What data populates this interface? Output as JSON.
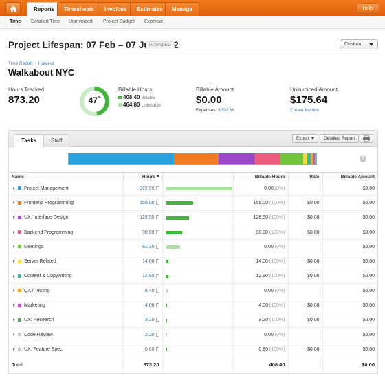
{
  "topnav": {
    "tabs": [
      {
        "label": "Reports",
        "active": true
      },
      {
        "label": "Timesheets",
        "active": false
      },
      {
        "label": "Invoices",
        "active": false
      },
      {
        "label": "Estimates",
        "active": false
      },
      {
        "label": "Manage",
        "active": false
      }
    ],
    "help_label": "Help"
  },
  "subnav": {
    "items": [
      "Time",
      "Detailed Time",
      "Uninvoiced",
      "Project Budget",
      "Expense"
    ]
  },
  "header": {
    "title": "Project Lifespan: 07 Feb – 07 Jun 2012",
    "badge": "ROUNDED",
    "range_select": "Custom"
  },
  "breadcrumb": {
    "items": [
      "Time Report",
      "Harvest"
    ]
  },
  "client_name": "Walkabout NYC",
  "stats": {
    "hours_tracked_label": "Hours Tracked",
    "hours_tracked_value": "873.20",
    "billable_percent": "47",
    "billable_percent_sign": "%",
    "billable_fraction": 0.47,
    "billable_hours_label": "Billable Hours",
    "billable_value": "408.40",
    "billable_sub": "Billable",
    "unbillable_value": "464.80",
    "unbillable_sub": "Unbillable",
    "billable_amount_label": "Billable Amount",
    "billable_amount_value": "$0.00",
    "expenses_label": "Expenses:",
    "expenses_value": "$220.58",
    "uninvoiced_label": "Uninvoiced Amount",
    "uninvoiced_value": "$175.64",
    "create_invoice_label": "Create Invoice"
  },
  "panel": {
    "tabs": [
      "Tasks",
      "Staff"
    ],
    "export_label": "Export",
    "detailed_report_label": "Detailed Report",
    "help_glyph": "?"
  },
  "table": {
    "headers": {
      "name": "Name",
      "hours": "Hours",
      "billable_hours": "Billable Hours",
      "rate": "Rate",
      "billable_amount": "Billable Amount"
    },
    "max_hours": 372.9,
    "rows": [
      {
        "name": "Project Management",
        "color": "#29a3dd",
        "hours": "372.90",
        "hours_num": 372.9,
        "bar_color": "#a8e2a0",
        "billable": "0.00",
        "pct": "(0%)",
        "rate": "",
        "amount": "$0.00"
      },
      {
        "name": "Frontend Programming",
        "color": "#f07b22",
        "hours": "155.00",
        "hours_num": 155.0,
        "bar_color": "#3fb83a",
        "billable": "155.00",
        "pct": "(100%)",
        "rate": "$0.00",
        "amount": "$0.00"
      },
      {
        "name": "UX: Interface Design",
        "color": "#9b45c9",
        "hours": "128.50",
        "hours_num": 128.5,
        "bar_color": "#3fb83a",
        "billable": "128.50",
        "pct": "(100%)",
        "rate": "$0.00",
        "amount": "$0.00"
      },
      {
        "name": "Backend Programming",
        "color": "#ec5b7d",
        "hours": "90.00",
        "hours_num": 90.0,
        "bar_color": "#3fb83a",
        "billable": "90.00",
        "pct": "(100%)",
        "rate": "$0.00",
        "amount": "$0.00"
      },
      {
        "name": "Meetings",
        "color": "#72c43a",
        "hours": "81.30",
        "hours_num": 81.3,
        "bar_color": "#a8e2a0",
        "billable": "0.00",
        "pct": "(0%)",
        "rate": "",
        "amount": "$0.00"
      },
      {
        "name": "Server Related",
        "color": "#f2d83a",
        "hours": "14.00",
        "hours_num": 14.0,
        "bar_color": "#3fb83a",
        "billable": "14.00",
        "pct": "(100%)",
        "rate": "$0.00",
        "amount": "$0.00"
      },
      {
        "name": "Content & Copywriting",
        "color": "#2fbfa0",
        "hours": "12.90",
        "hours_num": 12.9,
        "bar_color": "#3fb83a",
        "billable": "12.90",
        "pct": "(100%)",
        "rate": "$0.00",
        "amount": "$0.00"
      },
      {
        "name": "QA / Testing",
        "color": "#f5a623",
        "hours": "8.40",
        "hours_num": 8.4,
        "bar_color": "#a8e2a0",
        "billable": "0.00",
        "pct": "(0%)",
        "rate": "",
        "amount": "$0.00"
      },
      {
        "name": "Marketing",
        "color": "#c64fd0",
        "hours": "4.00",
        "hours_num": 4.0,
        "bar_color": "#3fb83a",
        "billable": "4.00",
        "pct": "(100%)",
        "rate": "$0.00",
        "amount": "$0.00"
      },
      {
        "name": "UX: Research",
        "color": "#5aa05a",
        "hours": "3.20",
        "hours_num": 3.2,
        "bar_color": "#3fb83a",
        "billable": "3.20",
        "pct": "(100%)",
        "rate": "$0.00",
        "amount": "$0.00"
      },
      {
        "name": "Code Review",
        "color": "#c8c8c8",
        "hours": "2.20",
        "hours_num": 2.2,
        "bar_color": "#a8e2a0",
        "billable": "0.00",
        "pct": "(0%)",
        "rate": "",
        "amount": "$0.00"
      },
      {
        "name": "UX: Feature Spec",
        "color": "#c8c8c8",
        "hours": "0.80",
        "hours_num": 0.8,
        "bar_color": "#3fb83a",
        "billable": "0.80",
        "pct": "(100%)",
        "rate": "$0.00",
        "amount": "$0.00"
      }
    ],
    "total": {
      "label": "Total",
      "hours": "873.20",
      "billable": "408.40",
      "amount": "$0.00"
    }
  }
}
